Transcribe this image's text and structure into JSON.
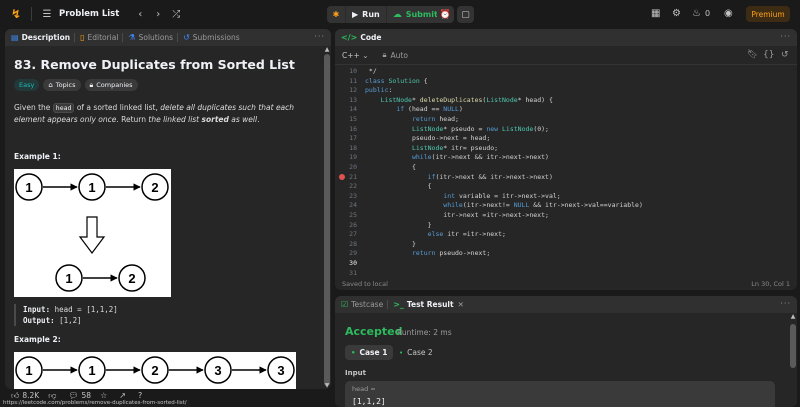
{
  "topbar": {
    "title": "Problem List",
    "run_label": "Run",
    "submit_label": "Submit",
    "notifications_count": "0",
    "premium_label": "Premium"
  },
  "desc_tabs": [
    "Description",
    "Editorial",
    "Solutions",
    "Submissions"
  ],
  "problem": {
    "title": "83. Remove Duplicates from Sorted List",
    "badges": [
      "Easy",
      "Topics",
      "Companies"
    ],
    "statement_pre": "Given the ",
    "statement_code": "head",
    "statement_mid": " of a sorted linked list, ",
    "statement_italic": "delete all duplicates such that each element appears only once",
    "statement_post1": ". Return ",
    "statement_italic2": "the linked list ",
    "statement_bold": "sorted",
    "statement_italic3": " as well",
    "statement_end": "."
  },
  "example1": {
    "label": "Example 1:",
    "diagram_top": [
      "1",
      "1",
      "2"
    ],
    "diagram_bottom": [
      "1",
      "2"
    ],
    "input_label": "Input:",
    "input_value": " head = [1,1,2]",
    "output_label": "Output:",
    "output_value": " [1,2]"
  },
  "example2": {
    "label": "Example 2:",
    "diagram": [
      "1",
      "1",
      "2",
      "3",
      "3"
    ]
  },
  "footer": {
    "likes": "8.2K",
    "comments": "58",
    "url": "https://leetcode.com/problems/remove-duplicates-from-sorted-list/"
  },
  "code_panel": {
    "tab_label": "Code",
    "language": "C++",
    "mode": "Auto",
    "saved": "Saved to local",
    "cursor": "Ln 30, Col 1"
  },
  "code_lines": [
    {
      "n": "10",
      "t": " */"
    },
    {
      "n": "11",
      "t": "class Solution {"
    },
    {
      "n": "12",
      "t": "public:"
    },
    {
      "n": "13",
      "t": "    ListNode* deleteDuplicates(ListNode* head) {"
    },
    {
      "n": "14",
      "t": "        if (head == NULL)"
    },
    {
      "n": "15",
      "t": "            return head;"
    },
    {
      "n": "16",
      "t": "            ListNode* pseudo = new ListNode(0);"
    },
    {
      "n": "17",
      "t": "            pseudo->next = head;"
    },
    {
      "n": "18",
      "t": "            ListNode* itr= pseudo;"
    },
    {
      "n": "19",
      "t": "            while(itr->next && itr->next->next)"
    },
    {
      "n": "20",
      "t": "            {"
    },
    {
      "n": "21",
      "t": "                if(itr->next && itr->next->next)"
    },
    {
      "n": "22",
      "t": "                {"
    },
    {
      "n": "23",
      "t": "                    int variable = itr->next->val;"
    },
    {
      "n": "24",
      "t": "                    while(itr->next!= NULL && itr->next->val==variable)"
    },
    {
      "n": "25",
      "t": "                    itr->next =itr->next->next;"
    },
    {
      "n": "26",
      "t": "                }"
    },
    {
      "n": "27",
      "t": "                else itr =itr->next;"
    },
    {
      "n": "28",
      "t": "            }"
    },
    {
      "n": "29",
      "t": "            return pseudo->next;"
    },
    {
      "n": "30",
      "t": ""
    },
    {
      "n": "31",
      "t": ""
    }
  ],
  "test_panel": {
    "tabs": [
      "Testcase",
      "Test Result"
    ],
    "status": "Accepted",
    "runtime": "Runtime: 2 ms",
    "cases": [
      "Case 1",
      "Case 2"
    ],
    "input_label": "Input",
    "param_name": "head =",
    "param_value": "[1,1,2]"
  },
  "colors": {
    "accent": "#ffa116",
    "success": "#2cbb5d",
    "easy": "#1cbaba",
    "breakpoint": "#e05252"
  }
}
